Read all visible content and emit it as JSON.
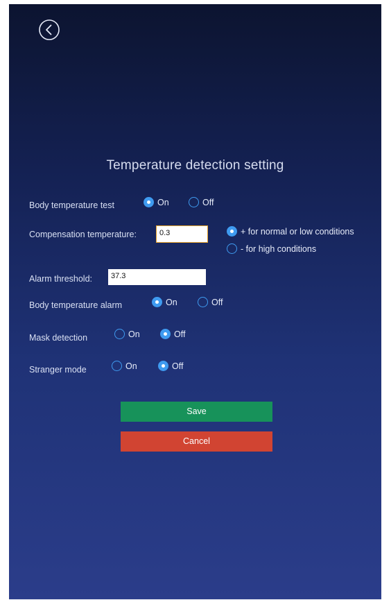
{
  "page": {
    "title": "Temperature detection setting"
  },
  "colors": {
    "accent_radio": "#3f9bf0",
    "save_button": "#17925a",
    "cancel_button": "#d14432",
    "input_focus_border": "#e7a32b"
  },
  "icons": {
    "back": "back-arrow-circle-icon"
  },
  "settings": {
    "body_temperature_test": {
      "label": "Body temperature test",
      "on": "On",
      "off": "Off",
      "selected": "On"
    },
    "compensation": {
      "label": "Compensation temperature:",
      "value": "0.3",
      "option_plus": "+ for normal or low conditions",
      "option_minus": "- for high conditions",
      "selected": "+ for normal or low conditions"
    },
    "alarm_threshold": {
      "label": "Alarm threshold:",
      "value": "37.3"
    },
    "body_temperature_alarm": {
      "label": "Body temperature alarm",
      "on": "On",
      "off": "Off",
      "selected": "On"
    },
    "mask_detection": {
      "label": "Mask detection",
      "on": "On",
      "off": "Off",
      "selected": "Off"
    },
    "stranger_mode": {
      "label": "Stranger mode",
      "on": "On",
      "off": "Off",
      "selected": "Off"
    }
  },
  "buttons": {
    "save": "Save",
    "cancel": "Cancel"
  }
}
